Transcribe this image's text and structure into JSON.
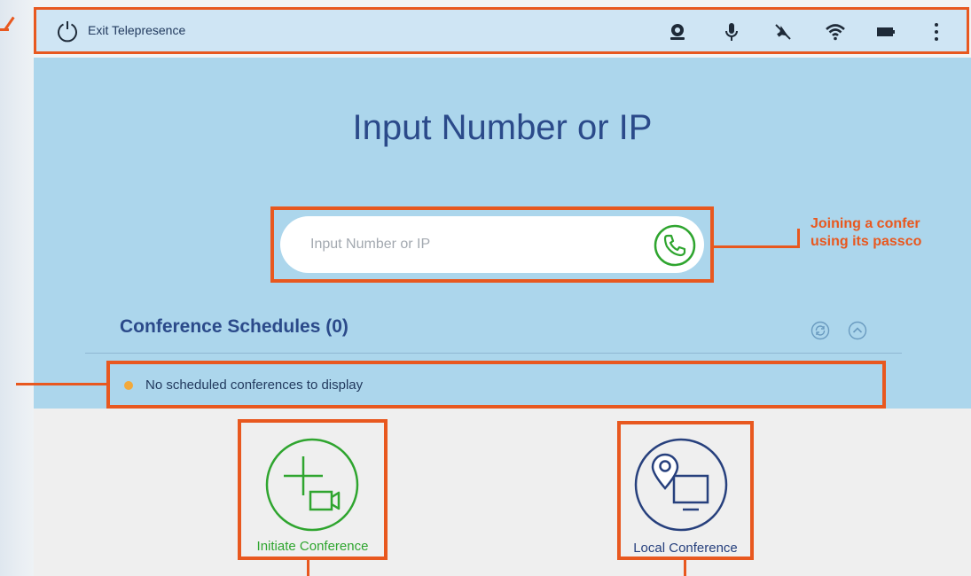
{
  "status_bar": {
    "exit_label": "Exit Telepresence",
    "icons": [
      "power-icon",
      "camera-icon",
      "microphone-icon",
      "speaker-muted-icon",
      "wifi-icon",
      "battery-icon",
      "more-vertical-icon"
    ]
  },
  "main": {
    "title": "Input Number or IP",
    "input": {
      "placeholder": "Input Number or IP",
      "value": ""
    }
  },
  "callout": {
    "line1": "Joining a confer",
    "line2": "using its passco"
  },
  "schedules": {
    "title": "Conference Schedules (0)",
    "empty_message": "No scheduled conferences to display"
  },
  "actions": {
    "initiate": {
      "label": "Initiate Conference",
      "color": "#2fa52f"
    },
    "local": {
      "label": "Local Conference",
      "color": "#27407d"
    }
  },
  "colors": {
    "accent_orange": "#e8581f",
    "header_blue": "#2b4a8a",
    "panel_blue": "#acd6ec",
    "status_bar": "#cfe5f4",
    "notice_dot": "#f2a93b"
  }
}
